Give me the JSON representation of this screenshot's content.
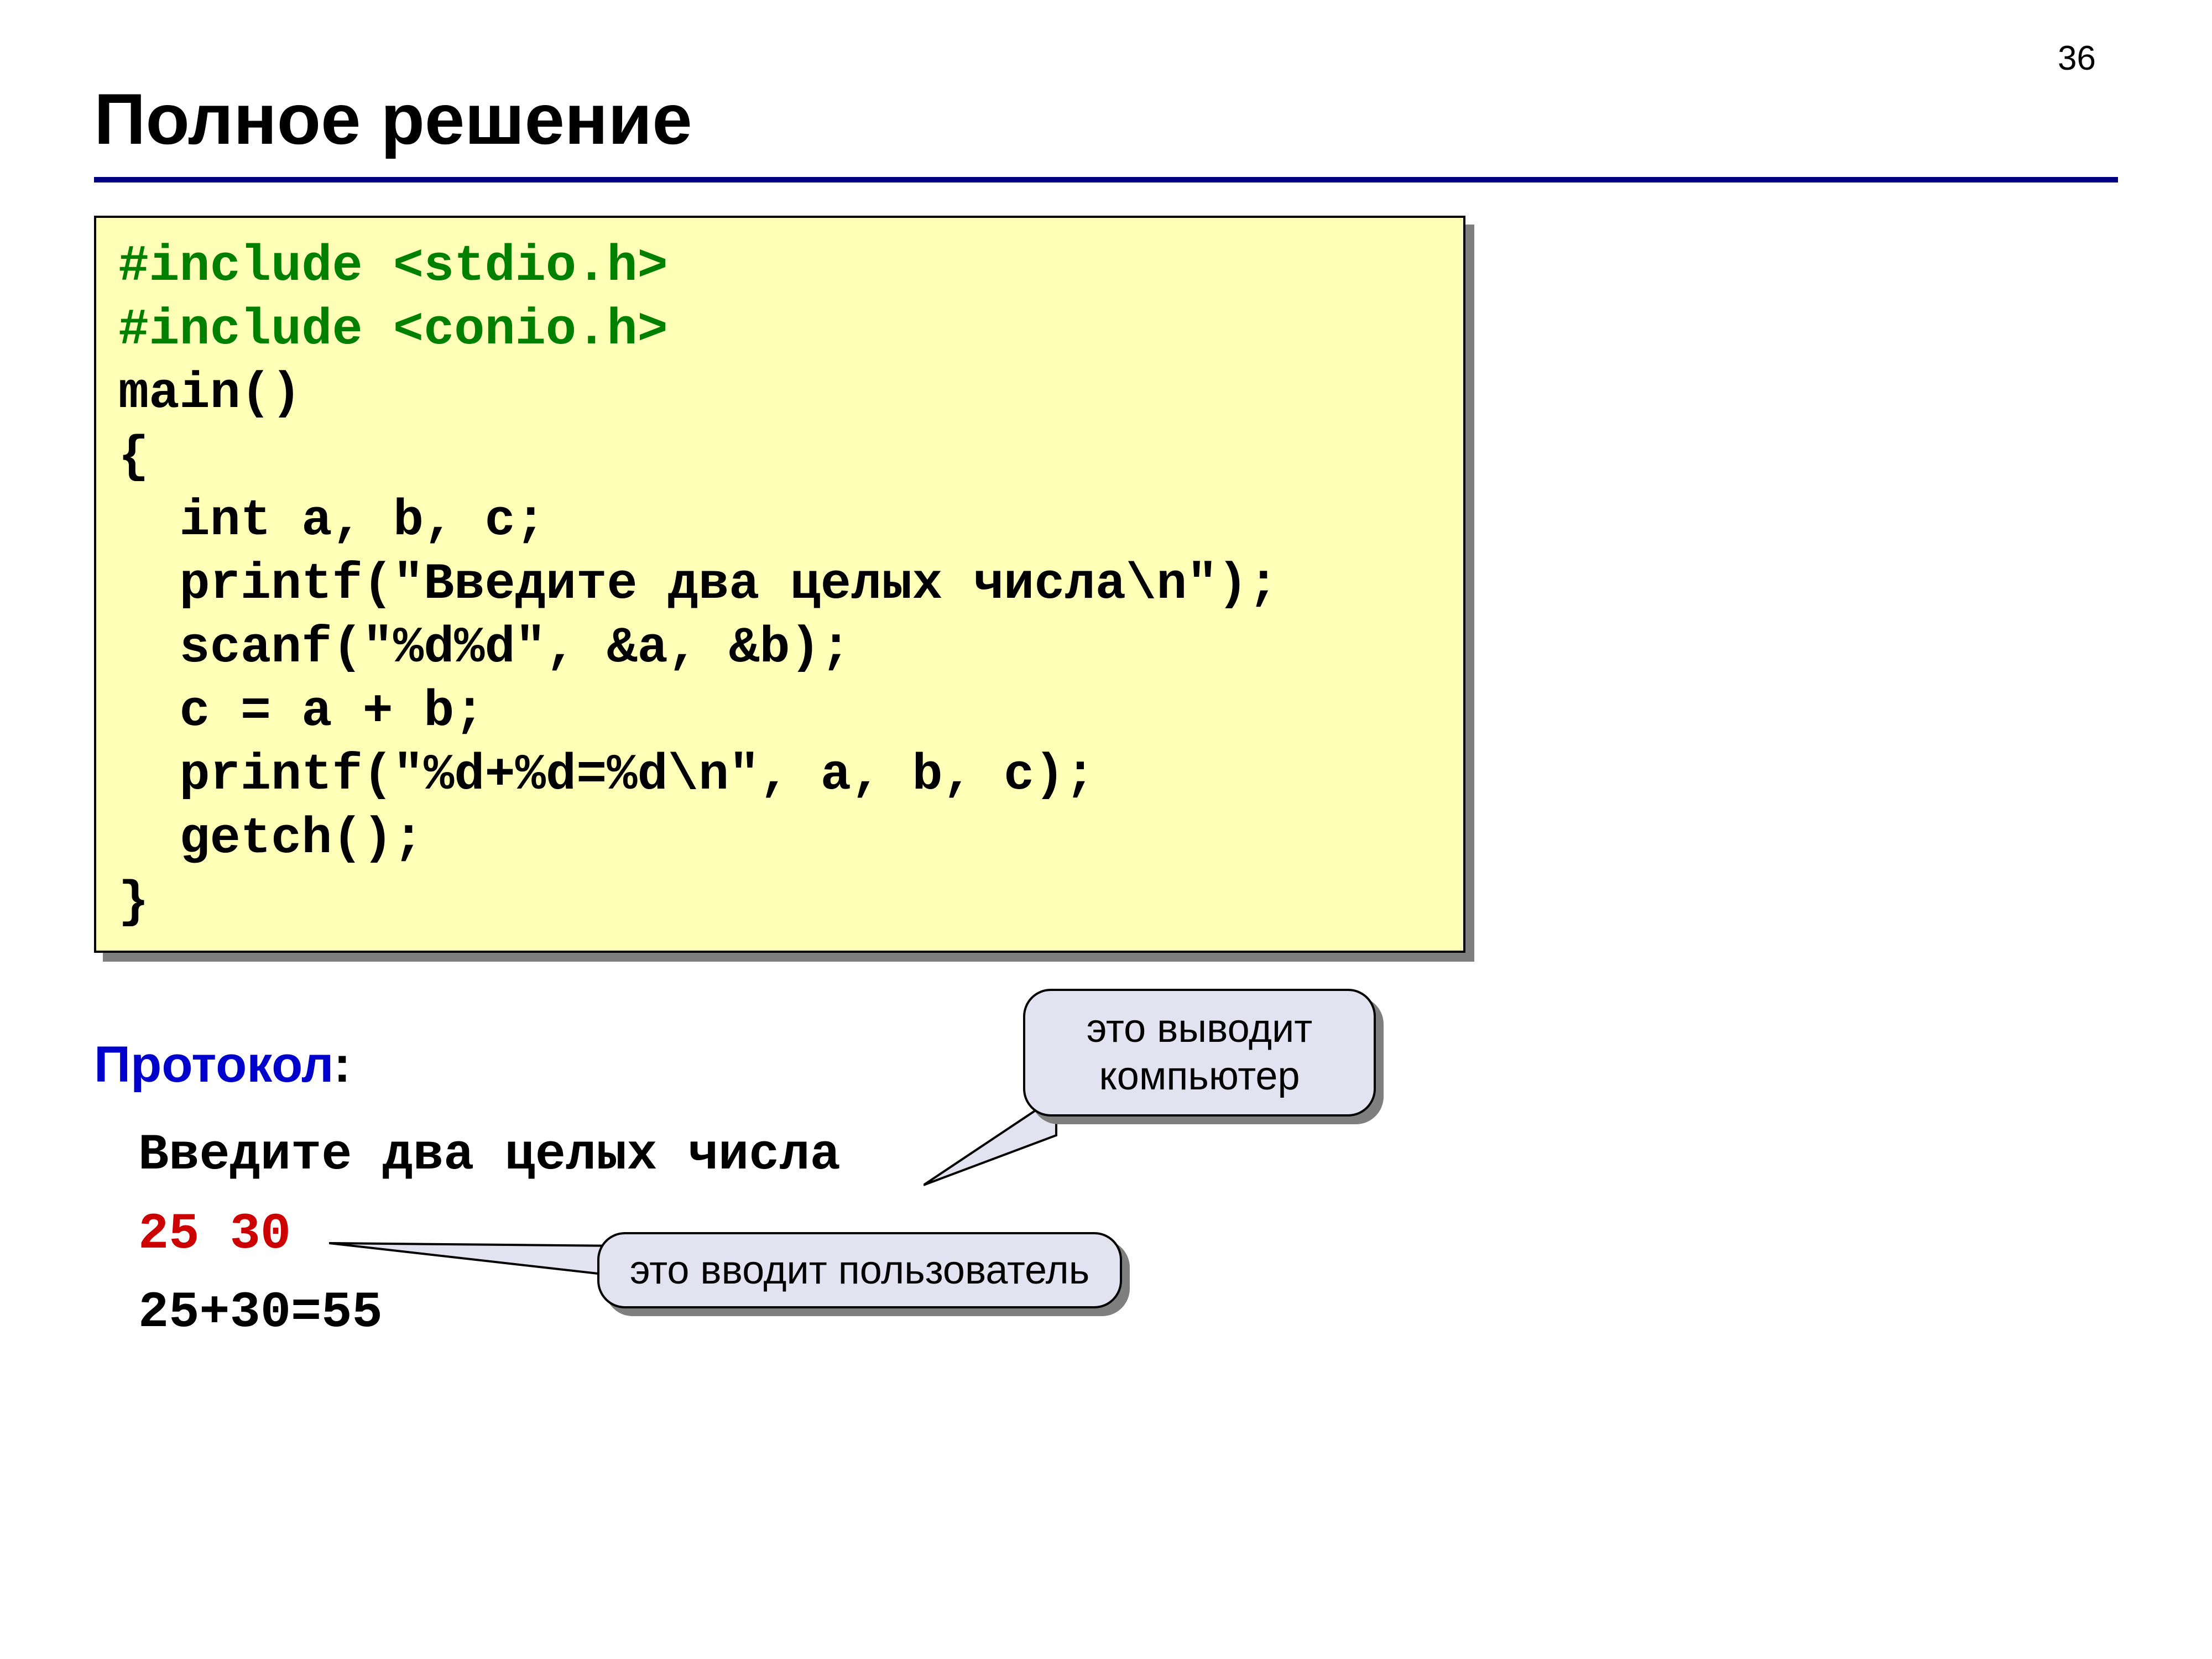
{
  "page_number": "36",
  "title": "Полное решение",
  "code": {
    "line1": "#include <stdio.h>",
    "line2": "#include <conio.h>",
    "line3": "main()",
    "line4": "{",
    "line5": "  int a, b, c;",
    "line6": "  printf(\"Введите два целых числа\\n\");",
    "line7": "  scanf(\"%d%d\", &a, &b);",
    "line8": "  c = a + b;",
    "line9": "  printf(\"%d+%d=%d\\n\", a, b, c);",
    "line10": "  getch();",
    "line11": "}"
  },
  "protocol": {
    "label": "Протокол",
    "colon": ":",
    "line1": "Введите два целых числа",
    "line2": "25 30",
    "line3": "25+30=55"
  },
  "callouts": {
    "computer_output_l1": "это выводит",
    "computer_output_l2": "компьютер",
    "user_input": "это вводит пользователь"
  }
}
